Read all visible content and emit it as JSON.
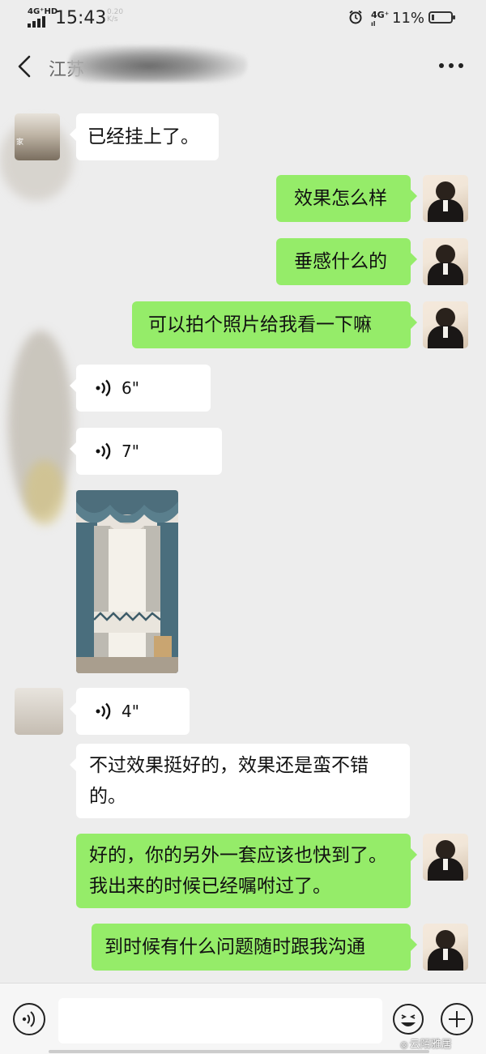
{
  "status_bar": {
    "network_left": "4G⁺HD",
    "time": "15:43",
    "speed": "0.20 K/s",
    "network_right": "4G⁺",
    "network_right_sub": "ıl",
    "battery": "11%"
  },
  "header": {
    "title": "江苏"
  },
  "messages": [
    {
      "side": "left",
      "type": "text",
      "text": "已经挂上了。"
    },
    {
      "side": "right",
      "type": "text",
      "text": "效果怎么样"
    },
    {
      "side": "right",
      "type": "text",
      "text": "垂感什么的"
    },
    {
      "side": "right",
      "type": "text",
      "text": "可以拍个照片给我看一下嘛"
    },
    {
      "side": "left",
      "type": "voice",
      "duration": "6\""
    },
    {
      "side": "left",
      "type": "voice",
      "duration": "7\""
    },
    {
      "side": "left",
      "type": "image",
      "description": "curtain-photo"
    },
    {
      "side": "left",
      "type": "voice",
      "duration": "4\""
    },
    {
      "side": "left",
      "type": "text",
      "text": "不过效果挺好的，效果还是蛮不错的。"
    },
    {
      "side": "right",
      "type": "text",
      "text": "好的，你的另外一套应该也快到了。我出来的时候已经嘱咐过了。"
    },
    {
      "side": "right",
      "type": "text",
      "text": "到时候有什么问题随时跟我沟通"
    }
  ],
  "avatar_left_label": "家",
  "bottom_bar": {
    "input_value": "",
    "watermark": "云陌雅居"
  }
}
